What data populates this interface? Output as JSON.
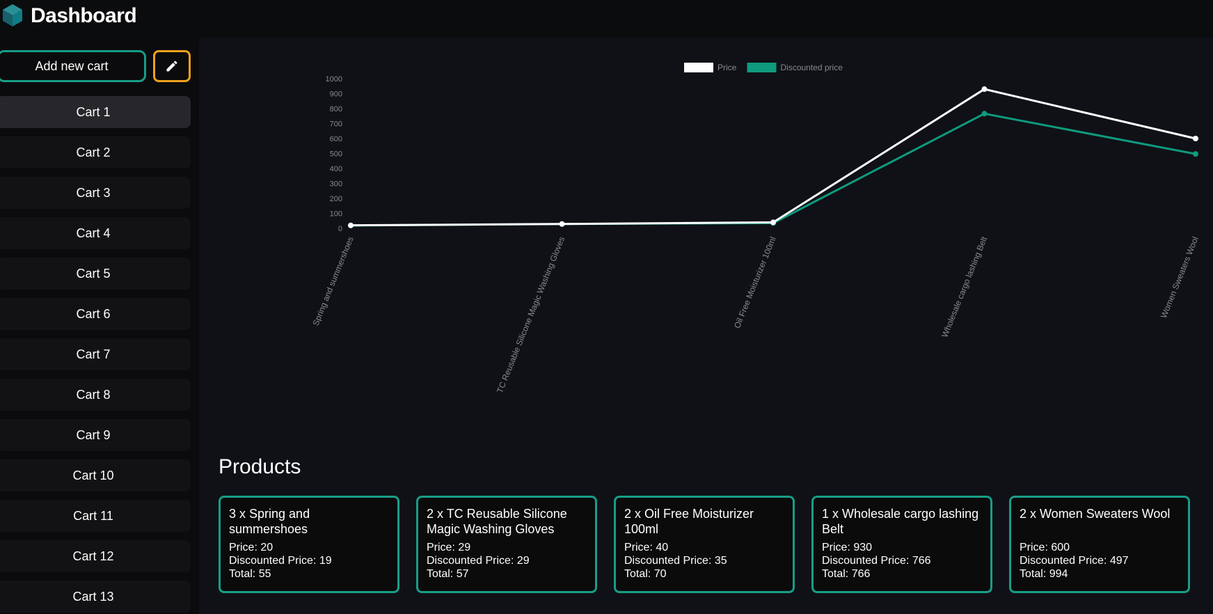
{
  "app": {
    "title": "Dashboard",
    "logo_icon": "cube-logo-icon"
  },
  "sidebar": {
    "add_cart_label": "Add new cart",
    "edit_icon": "pencil-icon",
    "carts": [
      "Cart 1",
      "Cart 2",
      "Cart 3",
      "Cart 4",
      "Cart 5",
      "Cart 6",
      "Cart 7",
      "Cart 8",
      "Cart 9",
      "Cart 10",
      "Cart 11",
      "Cart 12",
      "Cart 13"
    ],
    "active_cart": "Cart 1"
  },
  "colors": {
    "accent": "#179e87",
    "edit_border": "#f0a11c",
    "price_line": "#ffffff",
    "discounted_line": "#0f9a7e",
    "background": "#0f1116"
  },
  "chart_data": {
    "type": "line",
    "categories": [
      "Spring and summershoes",
      "TC Reusable Silicone Magic Washing Gloves",
      "Oil Free Moisturizer 100ml",
      "Wholesale cargo lashing Belt",
      "Women Sweaters Wool"
    ],
    "series": [
      {
        "name": "Price",
        "values": [
          20,
          29,
          40,
          930,
          600
        ],
        "color": "#ffffff"
      },
      {
        "name": "Discounted price",
        "values": [
          19,
          29,
          35,
          766,
          497
        ],
        "color": "#0f9a7e"
      }
    ],
    "ylim": [
      0,
      1000
    ],
    "yticks": [
      "0",
      "100",
      "200",
      "300",
      "400",
      "500",
      "600",
      "700",
      "800",
      "900",
      "1000"
    ],
    "legend": "top-center",
    "grid": false
  },
  "products": {
    "title": "Products",
    "items": [
      {
        "name": "3 x Spring and summershoes",
        "price": "Price: 20",
        "discounted": "Discounted Price: 19",
        "total": "Total: 55"
      },
      {
        "name": "2 x TC Reusable Silicone Magic Washing Gloves",
        "price": "Price: 29",
        "discounted": "Discounted Price: 29",
        "total": "Total: 57"
      },
      {
        "name": "2 x Oil Free Moisturizer 100ml",
        "price": "Price: 40",
        "discounted": "Discounted Price: 35",
        "total": "Total: 70"
      },
      {
        "name": "1 x Wholesale cargo lashing Belt",
        "price": "Price: 930",
        "discounted": "Discounted Price: 766",
        "total": "Total: 766"
      },
      {
        "name": "2 x Women Sweaters Wool",
        "price": "Price: 600",
        "discounted": "Discounted Price: 497",
        "total": "Total: 994"
      }
    ]
  }
}
